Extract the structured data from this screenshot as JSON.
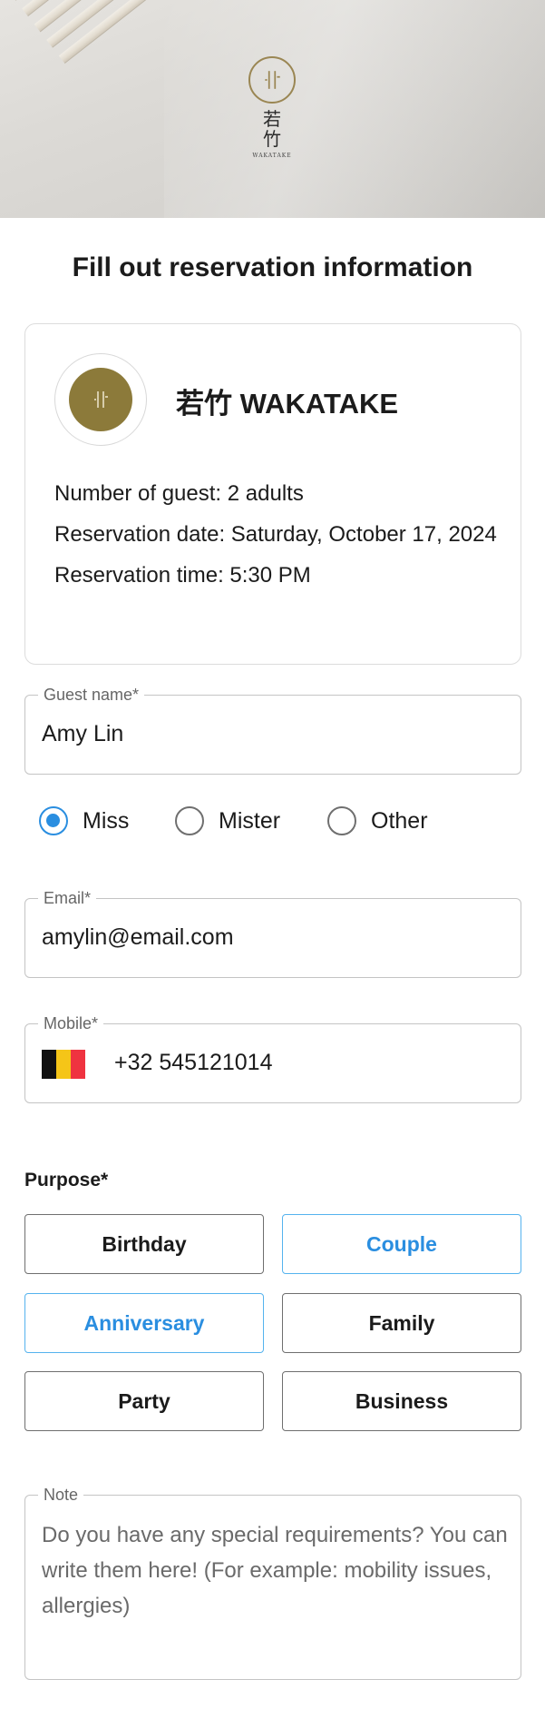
{
  "hero": {
    "logo_name_cjk": "若竹",
    "logo_name_en": "WAKATAKE"
  },
  "page_title": "Fill out reservation information",
  "restaurant": {
    "name": "若竹 WAKATAKE",
    "guests_line": "Number of guest: 2 adults",
    "date_line": "Reservation date: Saturday, October 17, 2024",
    "time_line": "Reservation time: 5:30 PM"
  },
  "guest_name": {
    "label": "Guest name*",
    "value": "Amy Lin"
  },
  "title_options": [
    {
      "label": "Miss",
      "selected": true
    },
    {
      "label": "Mister",
      "selected": false
    },
    {
      "label": "Other",
      "selected": false
    }
  ],
  "email": {
    "label": "Email*",
    "value": "amylin@email.com"
  },
  "mobile": {
    "label": "Mobile*",
    "value": "+32 545121014",
    "flag_colors": [
      "#111111",
      "#f5c518",
      "#ef3340"
    ]
  },
  "purpose": {
    "label": "Purpose*",
    "options": [
      {
        "label": "Birthday",
        "selected": false
      },
      {
        "label": "Couple",
        "selected": true
      },
      {
        "label": "Anniversary",
        "selected": true
      },
      {
        "label": "Family",
        "selected": false
      },
      {
        "label": "Party",
        "selected": false
      },
      {
        "label": "Business",
        "selected": false
      }
    ]
  },
  "note": {
    "label": "Note",
    "placeholder": "Do you have any special requirements? You can write them here! (For example: mobility issues, allergies)"
  },
  "colors": {
    "accent": "#2a8ee0",
    "brand_gold": "#8c7a3a"
  }
}
